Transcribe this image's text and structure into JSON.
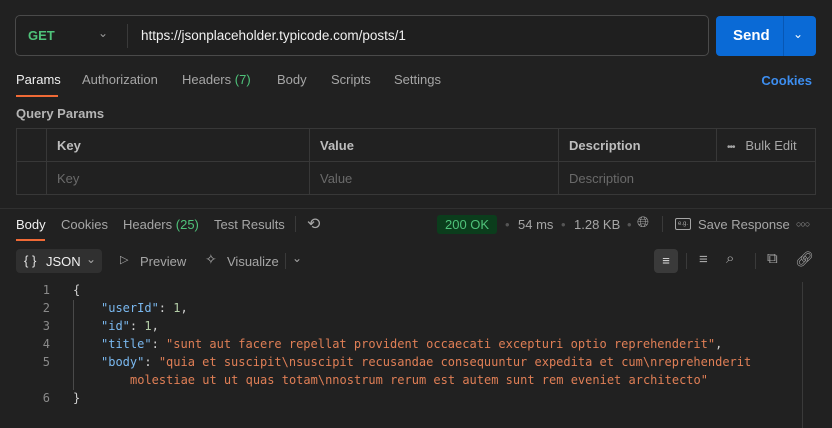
{
  "request": {
    "method": "GET",
    "url": "https://jsonplaceholder.typicode.com/posts/1",
    "send_label": "Send"
  },
  "request_tabs": [
    {
      "label": "Params"
    },
    {
      "label": "Authorization"
    },
    {
      "label": "Headers",
      "count": "(7)"
    },
    {
      "label": "Body"
    },
    {
      "label": "Scripts"
    },
    {
      "label": "Settings"
    }
  ],
  "cookies_link": "Cookies",
  "query_params": {
    "title": "Query Params",
    "headers": [
      "Key",
      "Value",
      "Description"
    ],
    "bulk_edit": "Bulk Edit",
    "placeholders": [
      "Key",
      "Value",
      "Description"
    ]
  },
  "response_tabs": [
    {
      "label": "Body"
    },
    {
      "label": "Cookies"
    },
    {
      "label": "Headers",
      "count": "(25)"
    },
    {
      "label": "Test Results"
    }
  ],
  "status": {
    "code": "200 OK",
    "time": "54 ms",
    "size": "1.28 KB",
    "save_label": "Save Response"
  },
  "toolbar": {
    "format": "JSON",
    "preview": "Preview",
    "visualize": "Visualize"
  },
  "code_lines": [
    {
      "n": "1",
      "text": "{"
    },
    {
      "n": "2",
      "key": "\"userId\"",
      "val": "1",
      "type": "num"
    },
    {
      "n": "3",
      "key": "\"id\"",
      "val": "1",
      "type": "num"
    },
    {
      "n": "4",
      "key": "\"title\"",
      "val": "\"sunt aut facere repellat provident occaecati excepturi optio reprehenderit\"",
      "type": "str"
    },
    {
      "n": "5",
      "key": "\"body\"",
      "val": "\"quia et suscipit\\nsuscipit recusandae consequuntur expedita et cum\\nreprehenderit",
      "type": "str"
    },
    {
      "n": "",
      "cont": "molestiae ut ut quas totam\\nnostrum rerum est autem sunt rem eveniet architecto\""
    },
    {
      "n": "6",
      "text": "}"
    }
  ]
}
